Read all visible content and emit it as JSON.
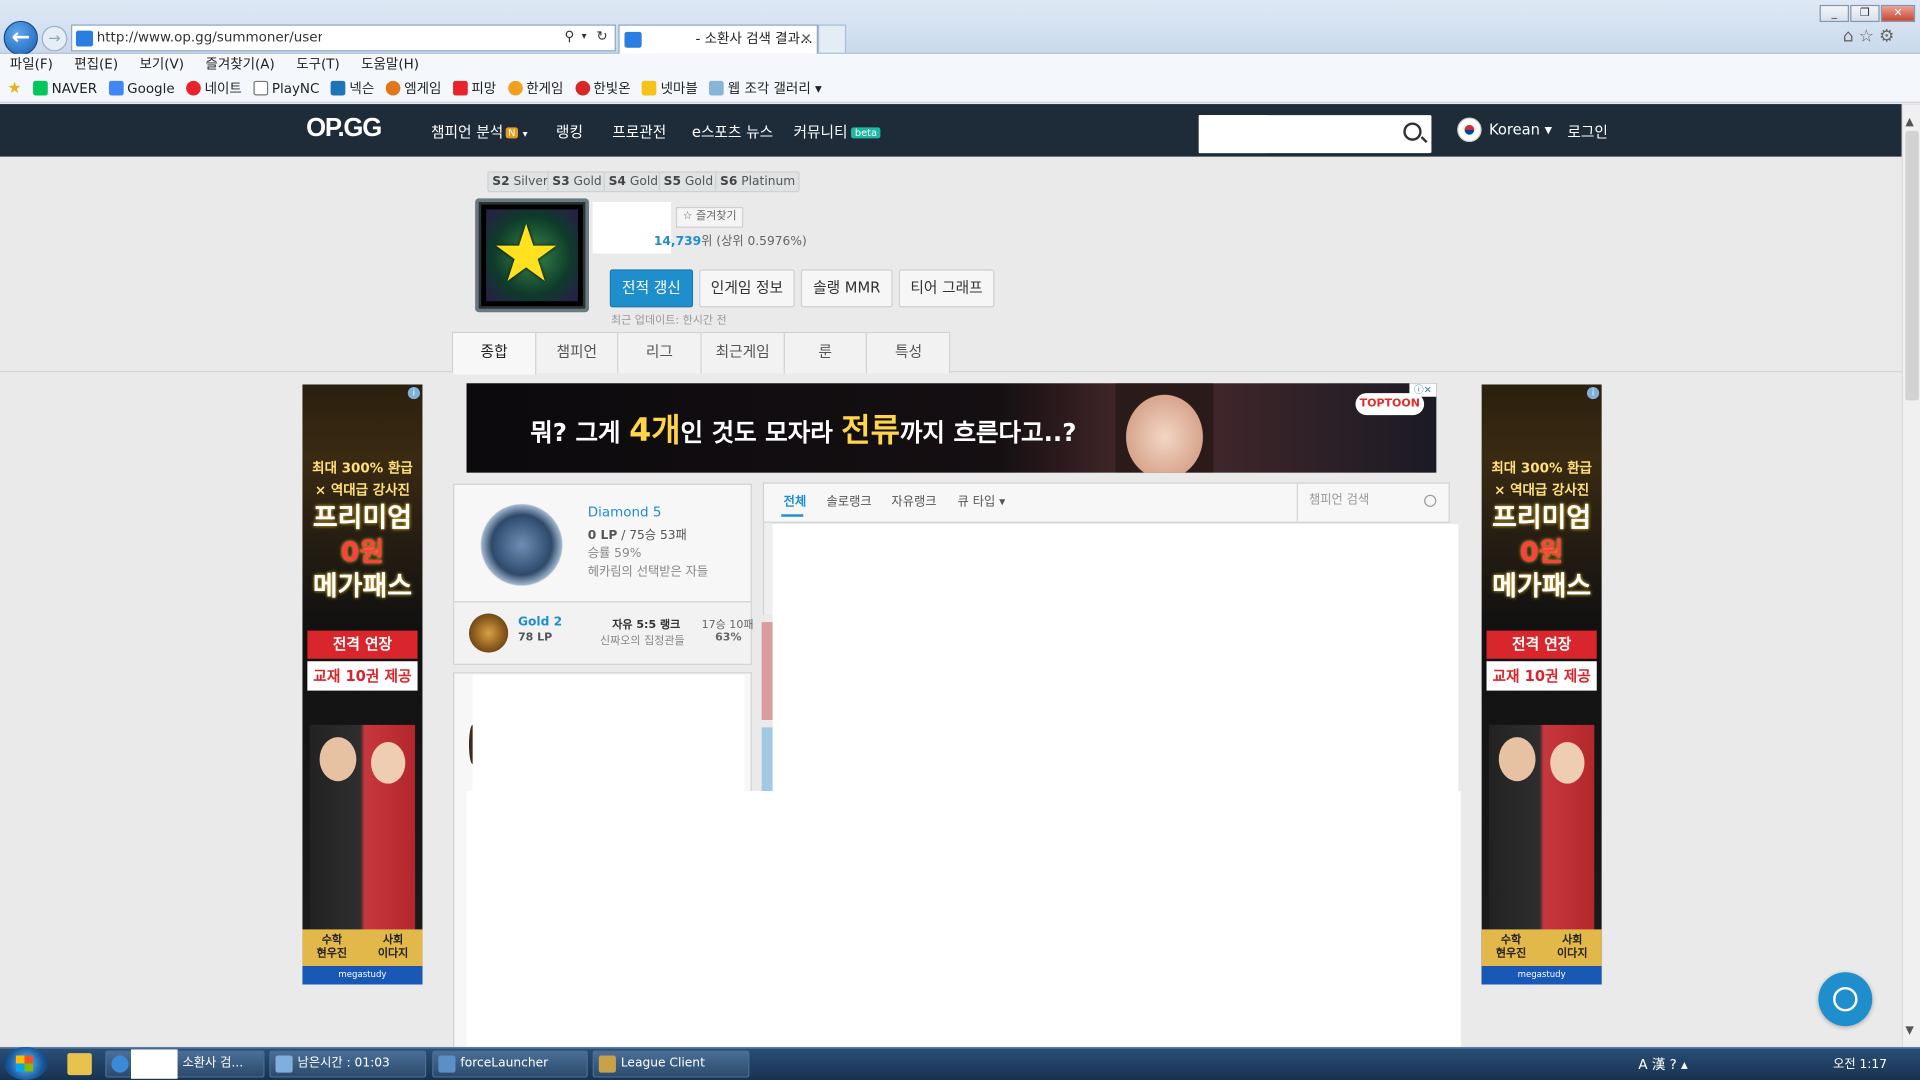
{
  "browser": {
    "url": "http://www.op.gg/summoner/userName=",
    "tab_title": "- 소환사 검색 결과...",
    "tab_close": "✕",
    "menu": [
      "파일(F)",
      "편집(E)",
      "보기(V)",
      "즐겨찾기(A)",
      "도구(T)",
      "도움말(H)"
    ],
    "favorites": [
      {
        "label": "NAVER",
        "color": "#03c75a"
      },
      {
        "label": "Google",
        "color": "#4285f4"
      },
      {
        "label": "네이트",
        "color": "#e8232b"
      },
      {
        "label": "PlayNC",
        "color": "#777777"
      },
      {
        "label": "넥슨",
        "color": "#1d74b8"
      },
      {
        "label": "엠게임",
        "color": "#e2761a"
      },
      {
        "label": "피망",
        "color": "#e8232b"
      },
      {
        "label": "한게임",
        "color": "#f0a020"
      },
      {
        "label": "한빛온",
        "color": "#d62828"
      },
      {
        "label": "넷마블",
        "color": "#f4c21b"
      },
      {
        "label": "웹 조각 갤러리 ▾",
        "color": "#8ab3d8"
      }
    ]
  },
  "header": {
    "logo": "OP.GG",
    "nav": {
      "champion": "챔피언 분석",
      "hot_badge": "N",
      "ranking": "랭킹",
      "pro": "프로관전",
      "esports": "e스포츠 뉴스",
      "community": "커뮤니티",
      "beta_badge": "beta"
    },
    "language": "Korean ▾",
    "login": "로그인"
  },
  "profile": {
    "past_seasons": [
      {
        "season": "S2",
        "tier": "Silver"
      },
      {
        "season": "S3",
        "tier": "Gold"
      },
      {
        "season": "S4",
        "tier": "Gold"
      },
      {
        "season": "S5",
        "tier": "Gold"
      },
      {
        "season": "S6",
        "tier": "Platinum"
      }
    ],
    "favorite_label": "☆ 즐겨찾기",
    "ladder_rank": "14,739",
    "ladder_suffix": "위 (상위 0.5976%)",
    "buttons": {
      "renew": "전적 갱신",
      "ingame": "인게임 정보",
      "mmr": "솔랭 MMR",
      "tier_graph": "티어 그래프"
    },
    "last_update": "최근 업데이트: 한시간 전",
    "tabs": [
      "종합",
      "챔피언",
      "리그",
      "최근게임",
      "룬",
      "특성"
    ]
  },
  "ads": {
    "side": {
      "line1": "최대 300% 환급",
      "line2": "× 역대급 강사진",
      "line3": "프리미엄",
      "line4": "0원",
      "line5": "메가패스",
      "red": "전격 연장",
      "white": "교재 10권 제공",
      "teacher1": "수학\n현우진",
      "teacher2": "사회\n이다지",
      "brand": "megastudy",
      "info": "i"
    },
    "top": {
      "text_a": "뭐? 그게 ",
      "text_b": "4개",
      "text_c": "인 것도 모자라 ",
      "text_d": "전류",
      "text_e": "까지 흐른다고..?",
      "badge": "TOPTOON",
      "adx": "ⓘ✕"
    }
  },
  "solo_rank": {
    "tier": "Diamond 5",
    "lp": "0 LP",
    "wl": " / 75승 53패",
    "winrate": "승률 59%",
    "league": "헤카림의 선택받은 자들"
  },
  "flex_rank": {
    "tier": "Gold 2",
    "lp": "78 LP",
    "type": "자유 5:5 랭크",
    "league": "신짜오의 집정관들",
    "wl": "17승 10패",
    "winrate": "63%"
  },
  "games": {
    "tabs": [
      "전체",
      "솔로랭크",
      "자유랭크",
      "큐 타입 ▾"
    ],
    "search_placeholder": "챔피언 검색"
  },
  "taskbar": {
    "items": [
      {
        "label": "소환사 검...",
        "color": "#3a8ad8"
      },
      {
        "label": "남은시간 : 01:03",
        "color": "#7fb0dd"
      },
      {
        "label": "forceLauncher",
        "color": "#5b8fc7"
      },
      {
        "label": "League Client",
        "color": "#c8a24a"
      }
    ],
    "clock": "오전 1:17",
    "tray": "A 漢 ? ▴"
  }
}
